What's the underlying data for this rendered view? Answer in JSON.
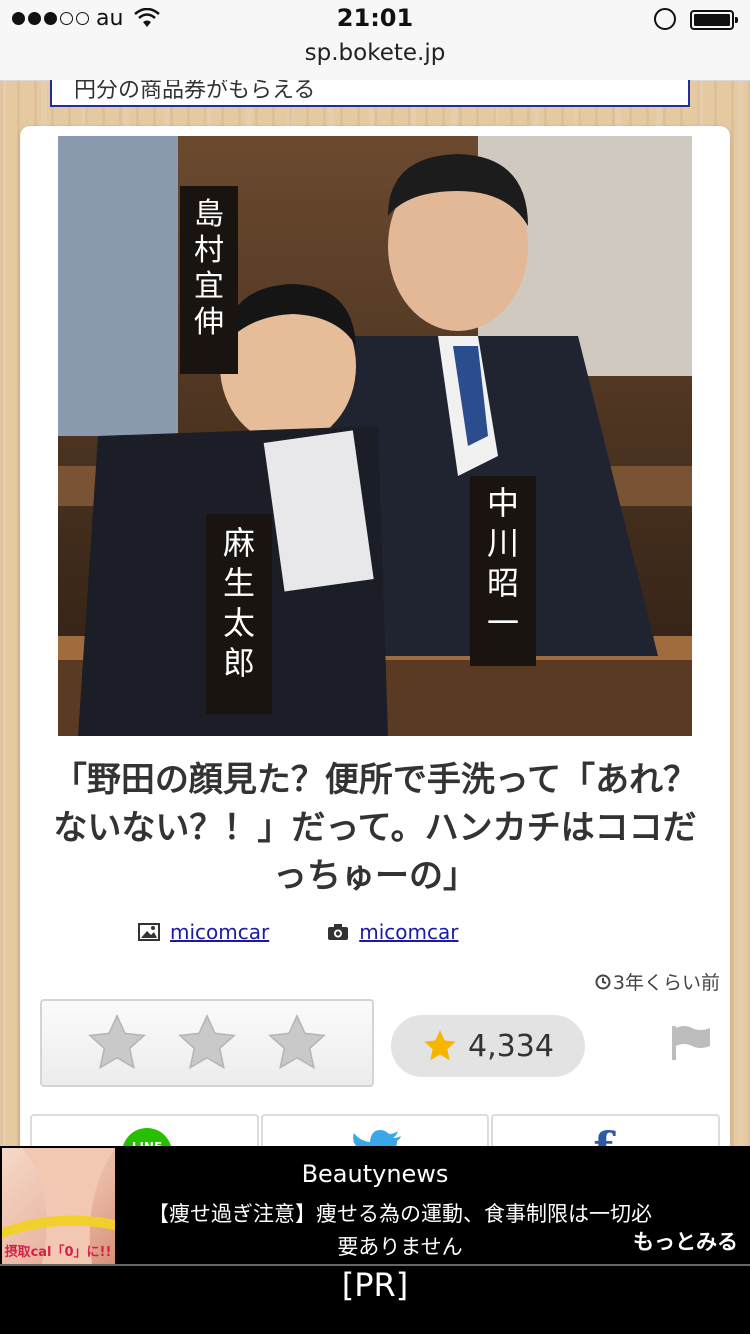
{
  "status_bar": {
    "carrier": "au",
    "time": "21:01",
    "url": "sp.bokete.jp"
  },
  "promo_banner": {
    "text": "円分の商品券がもらえる"
  },
  "post": {
    "name_plates": [
      "島村宜伸",
      "麻生太郎",
      "中川昭一"
    ],
    "caption": "「野田の顔見た？便所で手洗って「あれ？ないない？！」だって。ハンカチはココだっちゅーの」",
    "image_credit": "micomcar",
    "camera_credit": "micomcar",
    "time_ago": "3年くらい前",
    "star_count": "4,334",
    "rating_star_count": 3
  },
  "share": {
    "line_label": "LINE"
  },
  "ad": {
    "brand": "Beautynews",
    "text": "【痩せ過ぎ注意】痩せる為の運動、食事制限は一切必要ありません",
    "more_label": "もっとみる",
    "image_label": "摂取cal「0」に!!",
    "pr_label": "[PR]"
  },
  "colors": {
    "star_active": "#f7b500",
    "star_inactive": "#c9c9c9",
    "link": "#1a1aa8",
    "line_green": "#27c000",
    "twitter_blue": "#3aa8e8",
    "facebook_blue": "#2d5aa3"
  }
}
